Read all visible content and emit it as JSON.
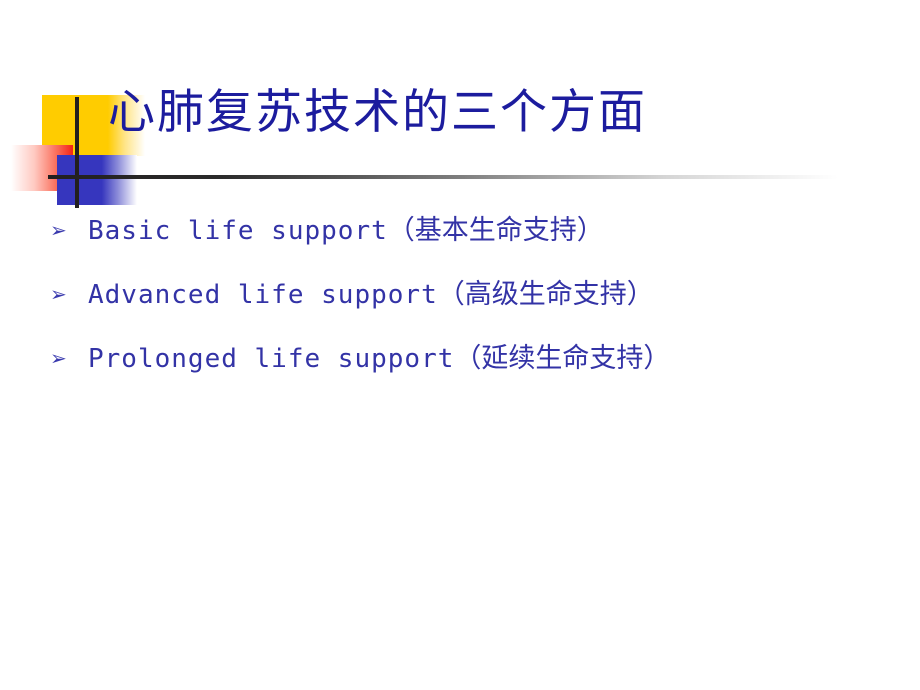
{
  "slide": {
    "title": "心肺复苏技术的三个方面",
    "title_color": "#1C1C9E",
    "background_color": "#FFFFFF",
    "bullet_marker": "➢",
    "bullets": [
      {
        "marker": "➢",
        "english": "Basic life support",
        "chinese": "（基本生命支持）"
      },
      {
        "marker": "➢",
        "english": "Advanced life support",
        "chinese": "（高级生命支持）"
      },
      {
        "marker": "➢",
        "english": "Prolonged life support",
        "chinese": "（延续生命支持）"
      }
    ],
    "body_text_color": "#3333A6",
    "ornament": {
      "yellow_color": "#FFCC00",
      "red_color": "#F42314",
      "blue_color": "#3636BE",
      "rule_color": "#221F1F"
    }
  }
}
